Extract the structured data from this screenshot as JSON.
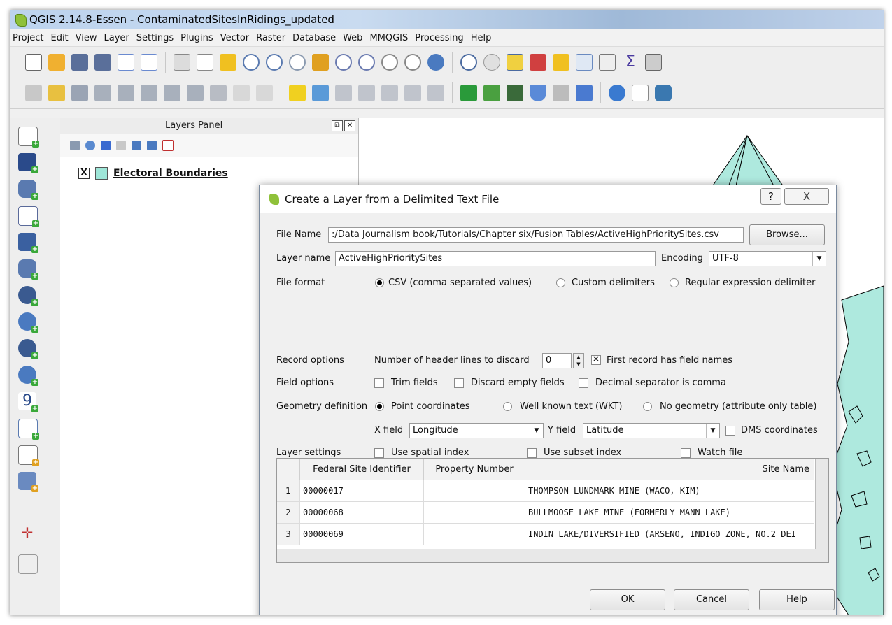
{
  "window": {
    "title": "QGIS 2.14.8-Essen - ContaminatedSitesInRidings_updated"
  },
  "menu": [
    "Project",
    "Edit",
    "View",
    "Layer",
    "Settings",
    "Plugins",
    "Vector",
    "Raster",
    "Database",
    "Web",
    "MMQGIS",
    "Processing",
    "Help"
  ],
  "layers_panel": {
    "title": "Layers Panel",
    "layers": [
      {
        "name": "Electoral Boundaries",
        "checked": "X",
        "color": "#9ee6d8"
      }
    ]
  },
  "dialog": {
    "title": "Create a Layer from a Delimited Text File",
    "help_glyph": "?",
    "close_glyph": "X",
    "file_name_label": "File Name",
    "file_name_value": ":/Data Journalism book/Tutorials/Chapter six/Fusion Tables/ActiveHighPrioritySites.csv",
    "browse_label": "Browse...",
    "layer_name_label": "Layer name",
    "layer_name_value": "ActiveHighPrioritySites",
    "encoding_label": "Encoding",
    "encoding_value": "UTF-8",
    "file_format_label": "File format",
    "format_csv": "CSV (comma separated values)",
    "format_custom": "Custom delimiters",
    "format_regex": "Regular expression delimiter",
    "record_options_label": "Record options",
    "header_lines_label": "Number of header lines to discard",
    "header_lines_value": "0",
    "first_record_label": "First record has field names",
    "field_options_label": "Field options",
    "trim_fields": "Trim fields",
    "discard_empty": "Discard empty fields",
    "decimal_comma": "Decimal separator is comma",
    "geometry_label": "Geometry definition",
    "geom_point": "Point coordinates",
    "geom_wkt": "Well known text (WKT)",
    "geom_none": "No geometry (attribute only table)",
    "x_field_label": "X field",
    "x_field_value": "Longitude",
    "y_field_label": "Y field",
    "y_field_value": "Latitude",
    "dms_label": "DMS coordinates",
    "layer_settings_label": "Layer settings",
    "spatial_index": "Use spatial index",
    "subset_index": "Use subset index",
    "watch_file": "Watch file",
    "table": {
      "columns": [
        "Federal Site Identifier",
        "Property Number",
        "Site Name"
      ],
      "rows": [
        {
          "n": "1",
          "id": "00000017",
          "prop": "",
          "name": "THOMPSON-LUNDMARK MINE (WACO, KIM)"
        },
        {
          "n": "2",
          "id": "00000068",
          "prop": "",
          "name": "BULLMOOSE LAKE MINE (FORMERLY MANN LAKE)"
        },
        {
          "n": "3",
          "id": "00000069",
          "prop": "",
          "name": "INDIN LAKE/DIVERSIFIED (ARSENO, INDIGO ZONE, NO.2 DEI"
        }
      ]
    },
    "ok_label": "OK",
    "cancel_label": "Cancel",
    "help_label": "Help"
  },
  "colors": {
    "map_fill": "#9ee6d8",
    "titlebar": "#c9dbf0"
  }
}
